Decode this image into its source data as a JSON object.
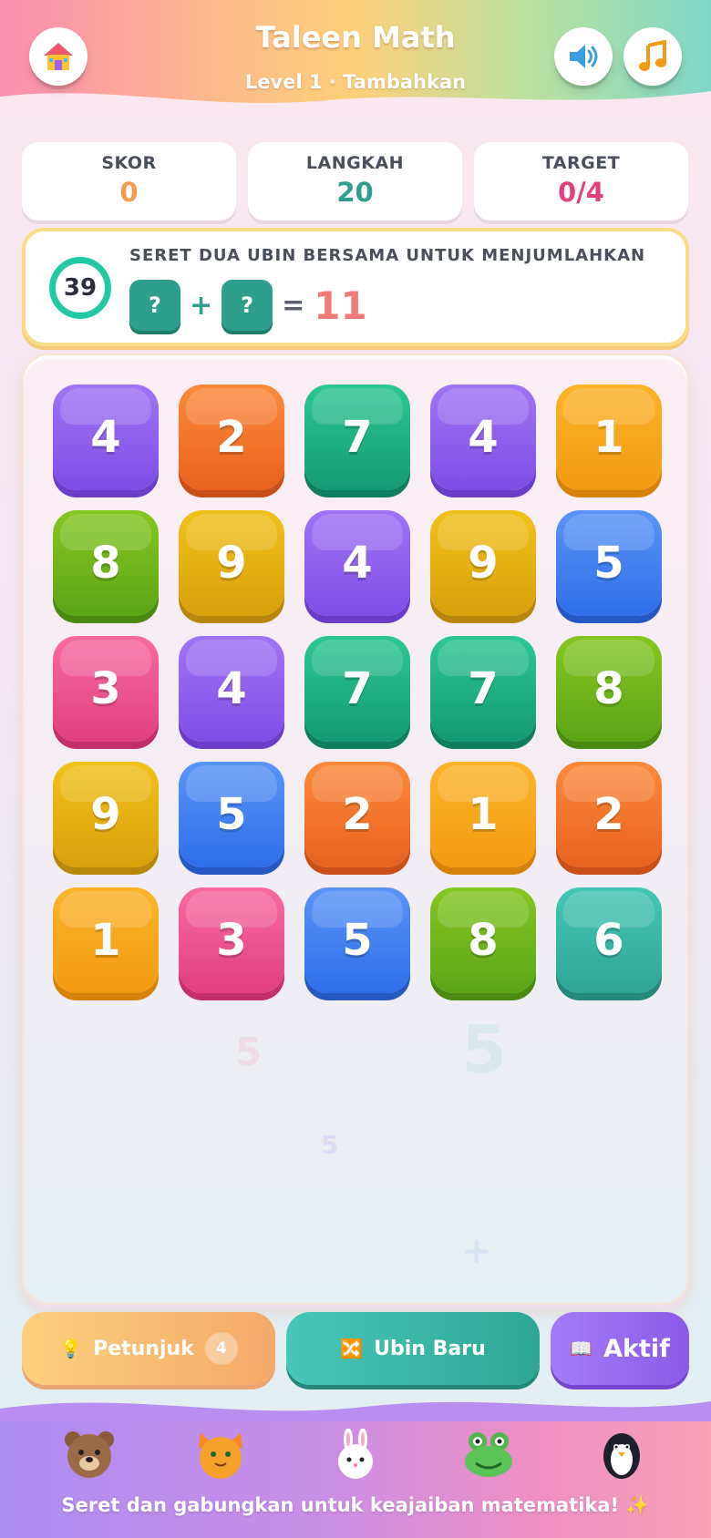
{
  "header": {
    "title": "Taleen Math",
    "subtitle": "Level 1 · Tambahkan",
    "home_icon": "house-icon",
    "sound_icon": "speaker-icon",
    "music_icon": "music-note-icon"
  },
  "stats": [
    {
      "label": "SKOR",
      "value": "0",
      "color": "#f49a4c"
    },
    {
      "label": "LANGKAH",
      "value": "20",
      "color": "#2e9f8c"
    },
    {
      "label": "TARGET",
      "value": "0/4",
      "color": "#e0407e"
    }
  ],
  "instruction": {
    "timer": "39",
    "text": "SERET DUA UBIN BERSAMA UNTUK MENJUMLAHKAN",
    "left": "?",
    "plus": "+",
    "right": "?",
    "equals": "=",
    "target": "11"
  },
  "board": {
    "rows": [
      [
        {
          "n": "4",
          "c": "purple"
        },
        {
          "n": "2",
          "c": "orange"
        },
        {
          "n": "7",
          "c": "green"
        },
        {
          "n": "4",
          "c": "purple"
        },
        {
          "n": "1",
          "c": "yellow"
        }
      ],
      [
        {
          "n": "8",
          "c": "lime"
        },
        {
          "n": "9",
          "c": "gold"
        },
        {
          "n": "4",
          "c": "purple"
        },
        {
          "n": "9",
          "c": "gold"
        },
        {
          "n": "5",
          "c": "blue"
        }
      ],
      [
        {
          "n": "3",
          "c": "pink"
        },
        {
          "n": "4",
          "c": "purple"
        },
        {
          "n": "7",
          "c": "green"
        },
        {
          "n": "7",
          "c": "green"
        },
        {
          "n": "8",
          "c": "lime"
        }
      ],
      [
        {
          "n": "9",
          "c": "gold"
        },
        {
          "n": "5",
          "c": "blue"
        },
        {
          "n": "2",
          "c": "orange"
        },
        {
          "n": "1",
          "c": "yellow"
        },
        {
          "n": "2",
          "c": "orange"
        }
      ],
      [
        {
          "n": "1",
          "c": "yellow"
        },
        {
          "n": "3",
          "c": "pink"
        },
        {
          "n": "5",
          "c": "blue"
        },
        {
          "n": "8",
          "c": "lime"
        },
        {
          "n": "6",
          "c": "teal"
        }
      ]
    ],
    "decorations": [
      "5",
      "5",
      "5",
      "+"
    ]
  },
  "actions": {
    "hint_label": "Petunjuk",
    "hint_count": "4",
    "hint_icon": "lightbulb-icon",
    "new_label": "Ubin Baru",
    "new_icon": "shuffle-icon",
    "active_label": "Aktif",
    "active_icon": "book-icon"
  },
  "footer": {
    "animals": [
      "bear-icon",
      "cat-icon",
      "bunny-icon",
      "frog-icon",
      "penguin-icon"
    ],
    "text": "Seret dan gabungkan untuk keajaiban matematika! ✨"
  }
}
